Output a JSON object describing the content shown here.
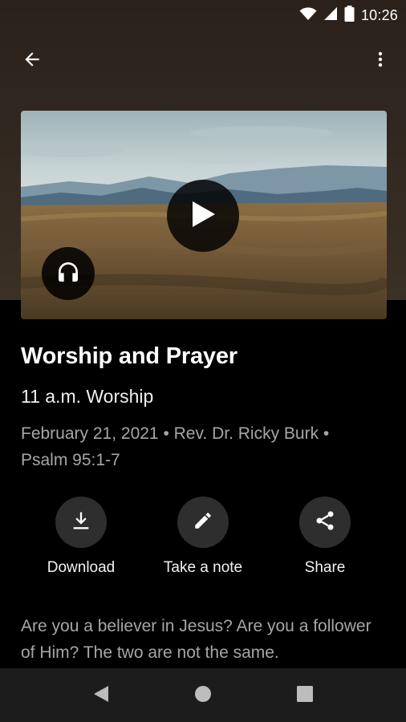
{
  "status_bar": {
    "time": "10:26",
    "icons": [
      "wifi-icon",
      "signal-icon",
      "battery-icon"
    ]
  },
  "app_bar": {
    "back_icon": "arrow-left-icon",
    "more_icon": "more-vertical-icon"
  },
  "media": {
    "play_icon": "play-icon",
    "audio_icon": "headphones-icon"
  },
  "sermon": {
    "title": "Worship and Prayer",
    "service": "11 a.m. Worship",
    "meta": "February 21, 2021 • Rev. Dr. Ricky Burk • Psalm 95:1-7"
  },
  "actions": [
    {
      "label": "Download",
      "icon": "download-icon"
    },
    {
      "label": "Take a note",
      "icon": "pencil-icon"
    },
    {
      "label": "Share",
      "icon": "share-icon"
    }
  ],
  "description": "Are you a believer in Jesus? Are you a follower of Him? The two are not the same.",
  "nav_bar": {
    "icons": [
      "nav-back-icon",
      "nav-home-icon",
      "nav-recents-icon"
    ]
  },
  "colors": {
    "header_bg": "#2f2620",
    "background": "#000000",
    "muted_text": "#a6a6a6",
    "action_circle": "#2e2e2e",
    "nav_bar_bg": "#1c1c1c"
  }
}
